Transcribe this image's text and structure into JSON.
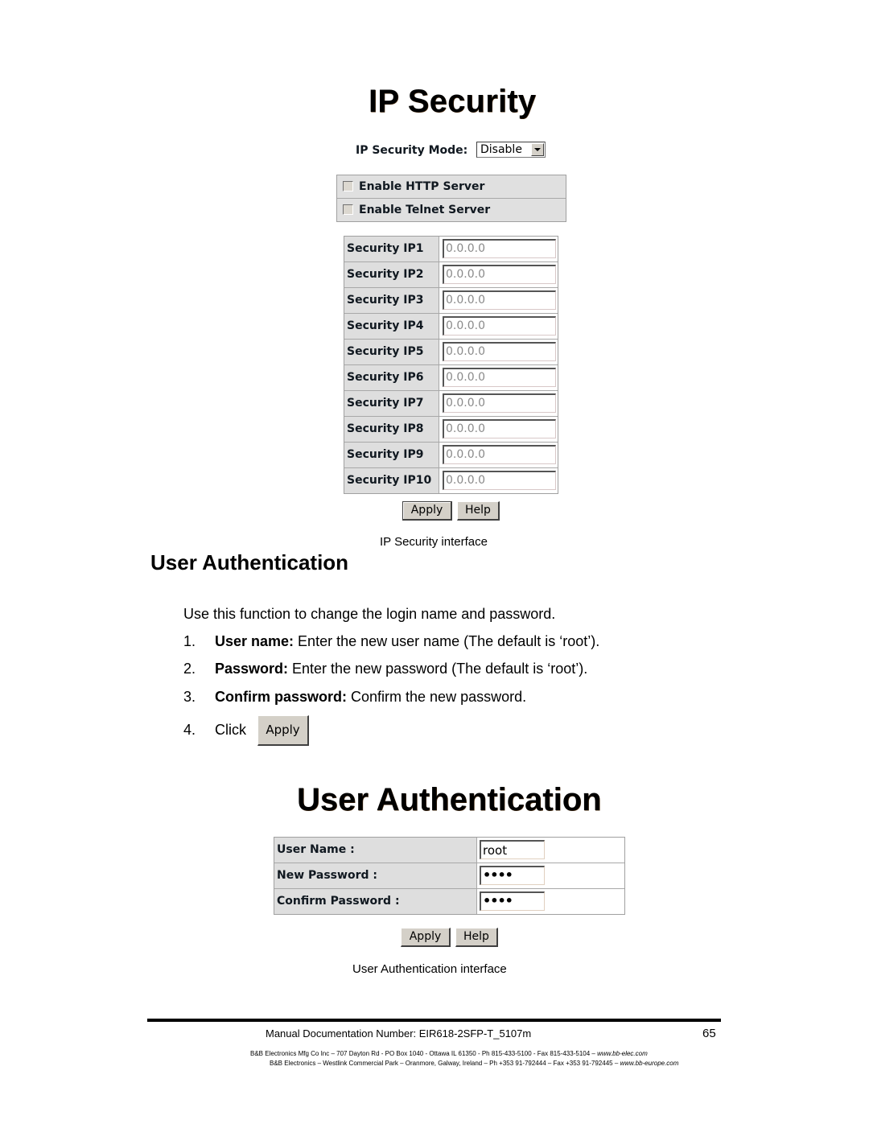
{
  "ip_security": {
    "title": "IP Security",
    "mode_label": "IP Security Mode:",
    "mode_value": "Disable",
    "servers": [
      {
        "label": "Enable HTTP Server",
        "checked": false
      },
      {
        "label": "Enable Telnet Server",
        "checked": false
      }
    ],
    "ips": [
      {
        "label": "Security IP1",
        "value": "0.0.0.0"
      },
      {
        "label": "Security IP2",
        "value": "0.0.0.0"
      },
      {
        "label": "Security IP3",
        "value": "0.0.0.0"
      },
      {
        "label": "Security IP4",
        "value": "0.0.0.0"
      },
      {
        "label": "Security IP5",
        "value": "0.0.0.0"
      },
      {
        "label": "Security IP6",
        "value": "0.0.0.0"
      },
      {
        "label": "Security IP7",
        "value": "0.0.0.0"
      },
      {
        "label": "Security IP8",
        "value": "0.0.0.0"
      },
      {
        "label": "Security IP9",
        "value": "0.0.0.0"
      },
      {
        "label": "Security IP10",
        "value": "0.0.0.0"
      }
    ],
    "apply_label": "Apply",
    "help_label": "Help",
    "caption": "IP Security interface"
  },
  "section": {
    "heading": "User Authentication",
    "intro": "Use this function to change the login name and password.",
    "steps": [
      {
        "num": "1.",
        "bold": "User name:",
        "text": " Enter the new user name (The default is ‘root’)."
      },
      {
        "num": "2.",
        "bold": "Password:",
        "text": " Enter the new password (The default is ‘root’)."
      },
      {
        "num": "3.",
        "bold": "Confirm password:",
        "text": " Confirm the new password."
      },
      {
        "num": "4.",
        "bold": "",
        "text": "Click"
      }
    ],
    "click_button_label": "Apply"
  },
  "user_auth": {
    "title": "User Authentication",
    "fields": [
      {
        "label": "User Name :",
        "value": "root"
      },
      {
        "label": "New Password :",
        "value": "••••"
      },
      {
        "label": "Confirm Password :",
        "value": "••••"
      }
    ],
    "apply_label": "Apply",
    "help_label": "Help",
    "caption": "User Authentication interface"
  },
  "footer": {
    "doc_number": "Manual Documentation Number: EIR618-2SFP-T_5107m",
    "page": "65",
    "address1": "B&B Electronics Mfg Co Inc – 707 Dayton Rd - PO Box 1040 - Ottawa IL 61350 - Ph 815-433-5100 - Fax 815-433-5104 – ",
    "url1": "www.bb-elec.com",
    "address2": "B&B Electronics – Westlink Commercial Park – Oranmore, Galway, Ireland – Ph +353 91-792444 – Fax +353 91-792445 – ",
    "url2": "www.bb-europe.com"
  }
}
